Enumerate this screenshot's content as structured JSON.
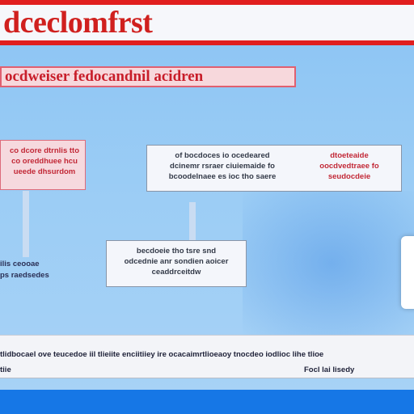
{
  "header": {
    "title": "dceclomfrst"
  },
  "banner": {
    "text": "ocdweiser fedocandnil acidren"
  },
  "left_box": {
    "lines": [
      "co dcore dtrnlis tto",
      "co oreddhuee hcu",
      "ueede dhsurdom"
    ]
  },
  "top_box": {
    "col_a": [
      "of bocdoces io ocedeared",
      "dcinemr rsraer ciuiemaide fo",
      "bcoodelnaee es ioc tho saere"
    ],
    "col_b": [
      "dtoeteaide",
      "oocdvedtraee fo",
      "seudocdeie"
    ]
  },
  "mid_box": {
    "lines": [
      "becdoeie tho tsre snd",
      "odcednie anr sondien aoicer",
      "ceaddrceitdw"
    ]
  },
  "side_text": {
    "lines": [
      "ilis ceooae",
      "ps raedsedes"
    ]
  },
  "footer": {
    "line1": "tlidbocael ove teucedoe iil tlieiite enciitiiey ire ocacaimrtlioeaoy tnocdeo iodlioc lihe tlioe",
    "line2_left": "tiie",
    "line2_right": "Focl lai lisedy"
  },
  "colors": {
    "header_red": "#e11f1f",
    "accent_red": "#c81e2a",
    "canvas_blue": "#9ccdf5",
    "bottom_bar_blue": "#1677e6"
  }
}
